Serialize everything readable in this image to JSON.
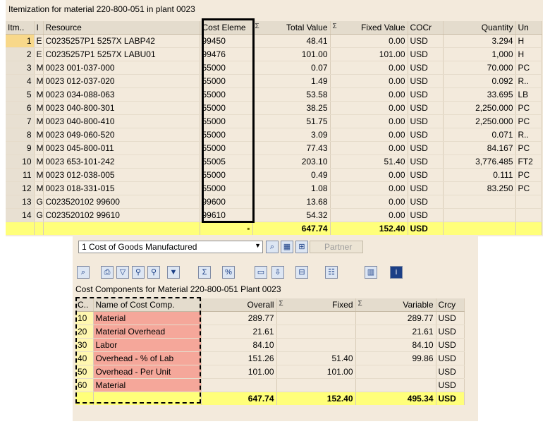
{
  "itemization": {
    "title": "Itemization for material 220-800-051 in plant 0023",
    "columns": [
      "Itm..",
      "I",
      "Resource",
      "Cost Eleme",
      "Total Value",
      "Fixed Value",
      "COCr",
      "Quantity",
      "Un"
    ],
    "rows": [
      {
        "itm": "1",
        "i": "E",
        "resource": "C0235257P1 5257X    LABP42",
        "cost": "99450",
        "total": "48.41",
        "fixed": "0.00",
        "cocr": "USD",
        "qty": "3.294",
        "un": "H"
      },
      {
        "itm": "2",
        "i": "E",
        "resource": "C0235257P1 5257X    LABU01",
        "cost": "99476",
        "total": "101.00",
        "fixed": "101.00",
        "cocr": "USD",
        "qty": "1,000",
        "un": "H"
      },
      {
        "itm": "3",
        "i": "M",
        "resource": "0023 001-037-000",
        "cost": "55000",
        "total": "0.07",
        "fixed": "0.00",
        "cocr": "USD",
        "qty": "70.000",
        "un": "PC"
      },
      {
        "itm": "4",
        "i": "M",
        "resource": "0023 012-037-020",
        "cost": "55000",
        "total": "1.49",
        "fixed": "0.00",
        "cocr": "USD",
        "qty": "0.092",
        "un": "R.."
      },
      {
        "itm": "5",
        "i": "M",
        "resource": "0023 034-088-063",
        "cost": "55000",
        "total": "53.58",
        "fixed": "0.00",
        "cocr": "USD",
        "qty": "33.695",
        "un": "LB"
      },
      {
        "itm": "6",
        "i": "M",
        "resource": "0023 040-800-301",
        "cost": "55000",
        "total": "38.25",
        "fixed": "0.00",
        "cocr": "USD",
        "qty": "2,250.000",
        "un": "PC"
      },
      {
        "itm": "7",
        "i": "M",
        "resource": "0023 040-800-410",
        "cost": "55000",
        "total": "51.75",
        "fixed": "0.00",
        "cocr": "USD",
        "qty": "2,250.000",
        "un": "PC"
      },
      {
        "itm": "8",
        "i": "M",
        "resource": "0023 049-060-520",
        "cost": "55000",
        "total": "3.09",
        "fixed": "0.00",
        "cocr": "USD",
        "qty": "0.071",
        "un": "R.."
      },
      {
        "itm": "9",
        "i": "M",
        "resource": "0023 045-800-011",
        "cost": "55000",
        "total": "77.43",
        "fixed": "0.00",
        "cocr": "USD",
        "qty": "84.167",
        "un": "PC"
      },
      {
        "itm": "10",
        "i": "M",
        "resource": "0023 653-101-242",
        "cost": "55005",
        "total": "203.10",
        "fixed": "51.40",
        "cocr": "USD",
        "qty": "3,776.485",
        "un": "FT2"
      },
      {
        "itm": "11",
        "i": "M",
        "resource": "0023 012-038-005",
        "cost": "55000",
        "total": "0.49",
        "fixed": "0.00",
        "cocr": "USD",
        "qty": "0.111",
        "un": "PC"
      },
      {
        "itm": "12",
        "i": "M",
        "resource": "0023 018-331-015",
        "cost": "55000",
        "total": "1.08",
        "fixed": "0.00",
        "cocr": "USD",
        "qty": "83.250",
        "un": "PC"
      },
      {
        "itm": "13",
        "i": "G",
        "resource": "C023520102 99600",
        "cost": "99600",
        "total": "13.68",
        "fixed": "0.00",
        "cocr": "USD",
        "qty": "",
        "un": ""
      },
      {
        "itm": "14",
        "i": "G",
        "resource": "C023520102 99610",
        "cost": "99610",
        "total": "54.32",
        "fixed": "0.00",
        "cocr": "USD",
        "qty": "",
        "un": ""
      }
    ],
    "total": {
      "dot1": "▪",
      "total": "647.74",
      "dot2": "▪",
      "fixed": "152.40",
      "cocr": "USD"
    }
  },
  "view_selector": {
    "value": "1 Cost of Goods Manufactured",
    "partner_label": "Partner"
  },
  "components": {
    "title": "Cost Components for Material 220-800-051 Plant 0023",
    "columns": [
      "C..",
      "Name of Cost Comp.",
      "Overall",
      "Fixed",
      "Variable",
      "Crcy"
    ],
    "rows": [
      {
        "c": "10",
        "name": "Material",
        "overall": "289.77",
        "fixed": "",
        "variable": "289.77",
        "crcy": "USD"
      },
      {
        "c": "20",
        "name": "Material Overhead",
        "overall": "21.61",
        "fixed": "",
        "variable": "21.61",
        "crcy": "USD"
      },
      {
        "c": "30",
        "name": "Labor",
        "overall": "84.10",
        "fixed": "",
        "variable": "84.10",
        "crcy": "USD"
      },
      {
        "c": "40",
        "name": "Overhead - % of Lab",
        "overall": "151.26",
        "fixed": "51.40",
        "variable": "99.86",
        "crcy": "USD"
      },
      {
        "c": "50",
        "name": "Overhead - Per Unit",
        "overall": "101.00",
        "fixed": "101.00",
        "variable": "",
        "crcy": "USD"
      },
      {
        "c": "60",
        "name": "Material",
        "overall": "",
        "fixed": "",
        "variable": "",
        "crcy": "USD"
      }
    ],
    "total": {
      "overall": "647.74",
      "fixed": "152.40",
      "variable": "495.34",
      "crcy": "USD",
      "dot": "▪"
    }
  },
  "icons": {
    "sigma": "Σ",
    "dropdown_arrow": "▼"
  }
}
